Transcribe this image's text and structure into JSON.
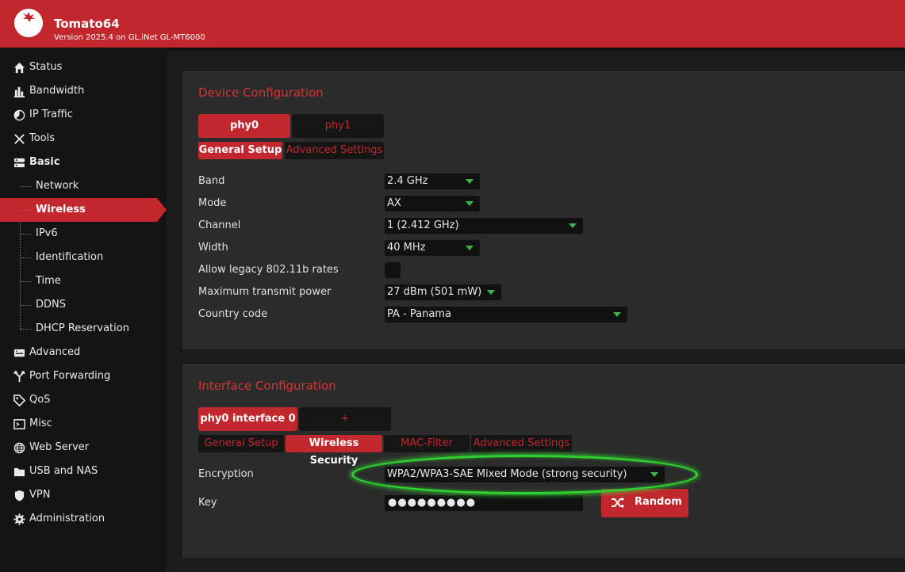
{
  "header": {
    "title": "Tomato64",
    "version": "Version 2025.4 on GL.iNet GL-MT6000",
    "logo_icon": "tomato-logo-icon"
  },
  "sidebar": {
    "items": [
      {
        "label": "Status",
        "icon": "home-icon"
      },
      {
        "label": "Bandwidth",
        "icon": "bar-chart-icon"
      },
      {
        "label": "IP Traffic",
        "icon": "pie-chart-icon"
      },
      {
        "label": "Tools",
        "icon": "tools-icon"
      },
      {
        "label": "Basic",
        "icon": "server-icon"
      },
      {
        "label": "Advanced",
        "icon": "router-icon"
      },
      {
        "label": "Port Forwarding",
        "icon": "forward-icon"
      },
      {
        "label": "QoS",
        "icon": "tag-icon"
      },
      {
        "label": "Misc",
        "icon": "terminal-icon"
      },
      {
        "label": "Web Server",
        "icon": "globe-icon"
      },
      {
        "label": "USB and NAS",
        "icon": "folder-icon"
      },
      {
        "label": "VPN",
        "icon": "shield-icon"
      },
      {
        "label": "Administration",
        "icon": "gear-icon"
      }
    ],
    "basic_subitems": [
      "Network",
      "Wireless",
      "IPv6",
      "Identification",
      "Time",
      "DDNS",
      "DHCP Reservation"
    ],
    "active_subitem": "Wireless"
  },
  "device": {
    "title": "Device Configuration",
    "phy_tabs": [
      "phy0",
      "phy1"
    ],
    "sub_tabs": [
      "General Setup",
      "Advanced Settings"
    ],
    "fields": {
      "band": {
        "label": "Band",
        "value": "2.4 GHz"
      },
      "mode": {
        "label": "Mode",
        "value": "AX"
      },
      "channel": {
        "label": "Channel",
        "value": "1 (2.412 GHz)"
      },
      "width": {
        "label": "Width",
        "value": "40 MHz"
      },
      "legacy": {
        "label": "Allow legacy 802.11b rates",
        "checked": false
      },
      "txpower": {
        "label": "Maximum transmit power",
        "value": "27 dBm (501 mW)"
      },
      "country": {
        "label": "Country code",
        "value": "PA - Panama"
      }
    }
  },
  "interface": {
    "title": "Interface Configuration",
    "iface_tabs": [
      "phy0 interface 0",
      "+"
    ],
    "sub_tabs": [
      "General Setup",
      "Wireless Security",
      "MAC-Filter",
      "Advanced Settings"
    ],
    "encryption": {
      "label": "Encryption",
      "value": "WPA2/WPA3-SAE Mixed Mode (strong security)"
    },
    "key": {
      "label": "Key",
      "value": "●●●●●●●●●"
    },
    "random_button": "Random"
  },
  "colors": {
    "accent": "#c1272d",
    "highlight": "#2fd32f",
    "caret": "#3ab54a"
  }
}
